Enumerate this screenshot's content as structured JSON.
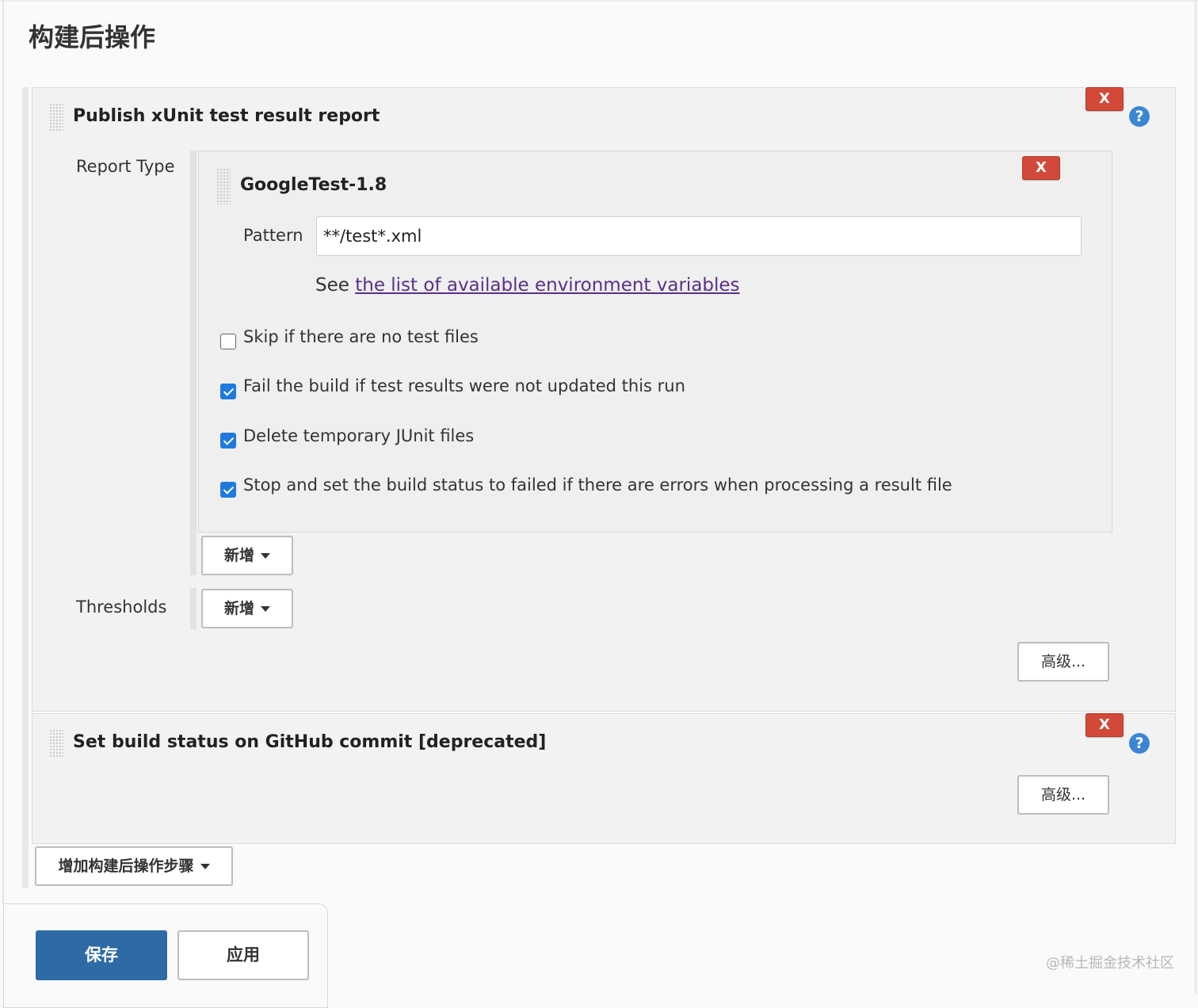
{
  "section": {
    "title": "构建后操作"
  },
  "xunit": {
    "title": "Publish xUnit test result report",
    "delete_label": "X",
    "help_label": "?",
    "report_type_label": "Report Type",
    "report": {
      "title": "GoogleTest-1.8",
      "delete_label": "X",
      "pattern_label": "Pattern",
      "pattern_value": "**/test*.xml",
      "see_prefix": "See",
      "env_link": "the list of available environment variables",
      "options": [
        {
          "label": "Skip if there are no test files",
          "checked": false
        },
        {
          "label": "Fail the build if test results were not updated this run",
          "checked": true
        },
        {
          "label": "Delete temporary JUnit files",
          "checked": true
        },
        {
          "label": "Stop and set the build status to failed if there are errors when processing a result file",
          "checked": true
        }
      ]
    },
    "add_report_label": "新增",
    "thresholds_label": "Thresholds",
    "add_threshold_label": "新增",
    "advanced_label": "高级..."
  },
  "github": {
    "title": "Set build status on GitHub commit [deprecated]",
    "delete_label": "X",
    "help_label": "?",
    "advanced_label": "高级..."
  },
  "add_step_label": "增加构建后操作步骤",
  "footer": {
    "save_label": "保存",
    "apply_label": "应用"
  },
  "watermark": "@稀土掘金技术社区",
  "colors": {
    "delete": "#d24939",
    "help": "#3b86d4",
    "save": "#2e6aa6",
    "link": "#5b2f8a",
    "checkbox": "#1f7ae0"
  }
}
